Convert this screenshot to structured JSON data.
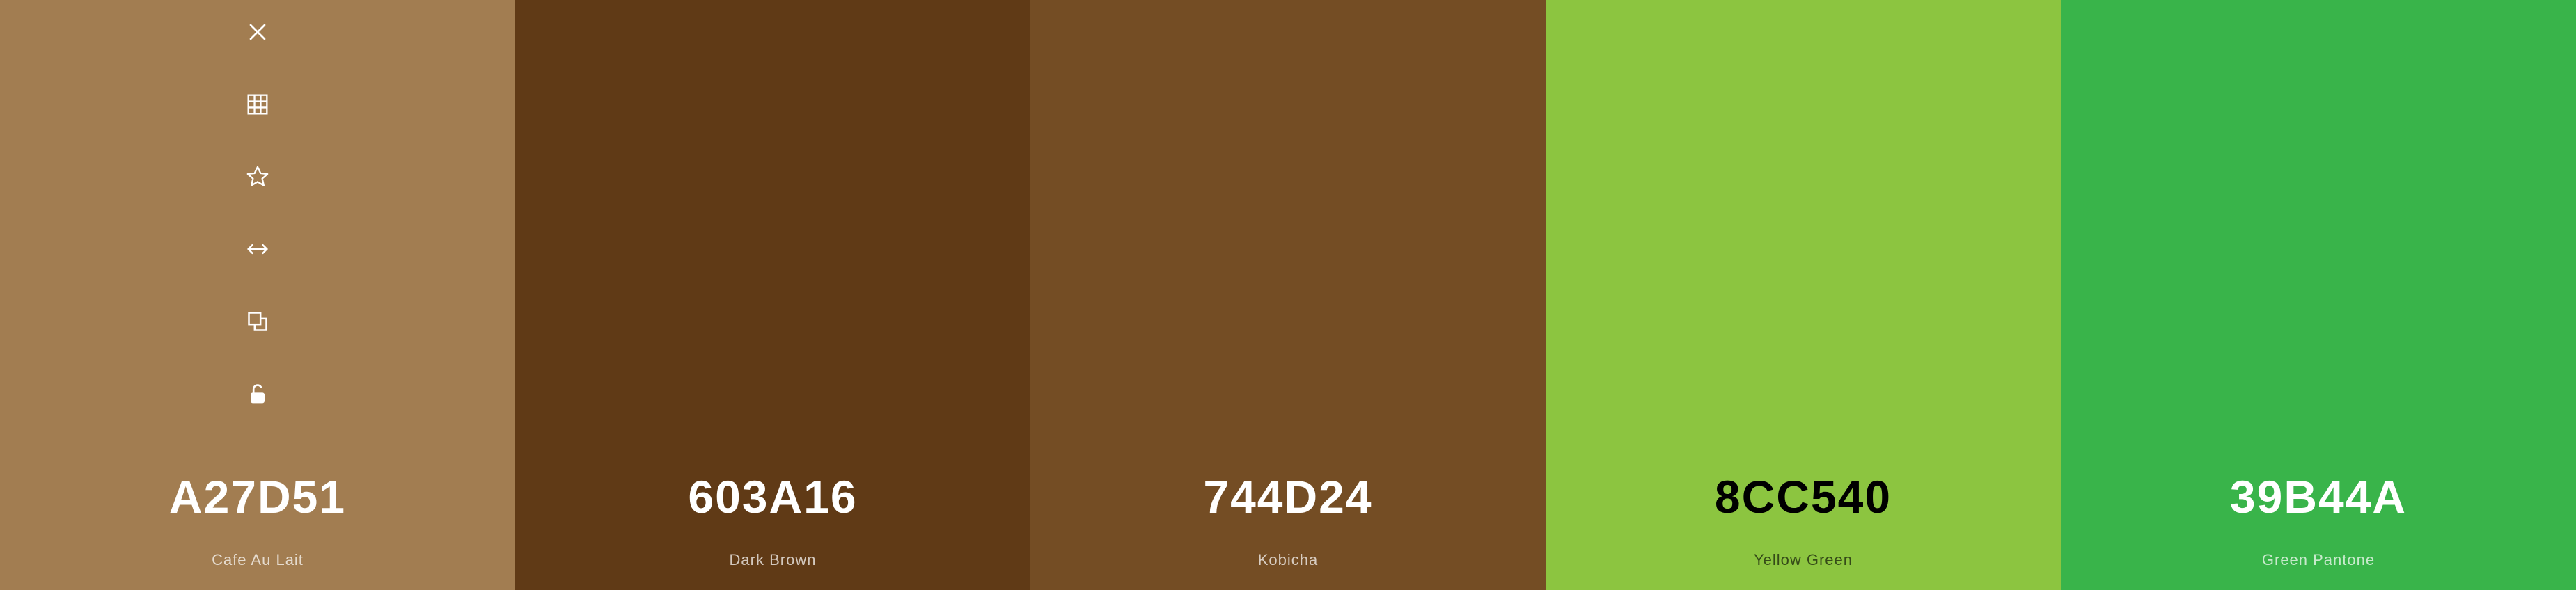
{
  "swatches": [
    {
      "hex": "A27D51",
      "name": "Cafe Au Lait",
      "color": "#A27D51",
      "text_theme": "light"
    },
    {
      "hex": "603A16",
      "name": "Dark Brown",
      "color": "#603A16",
      "text_theme": "light"
    },
    {
      "hex": "744D24",
      "name": "Kobicha",
      "color": "#744D24",
      "text_theme": "light"
    },
    {
      "hex": "8CC540",
      "name": "Yellow Green",
      "color": "#8CC540",
      "text_theme": "dark"
    },
    {
      "hex": "39B44A",
      "name": "Green Pantone",
      "color": "#39B44A",
      "text_theme": "light"
    }
  ],
  "toolbar_icons": [
    "close-icon",
    "grid-icon",
    "star-icon",
    "arrows-horizontal-icon",
    "copy-icon",
    "unlock-icon"
  ]
}
